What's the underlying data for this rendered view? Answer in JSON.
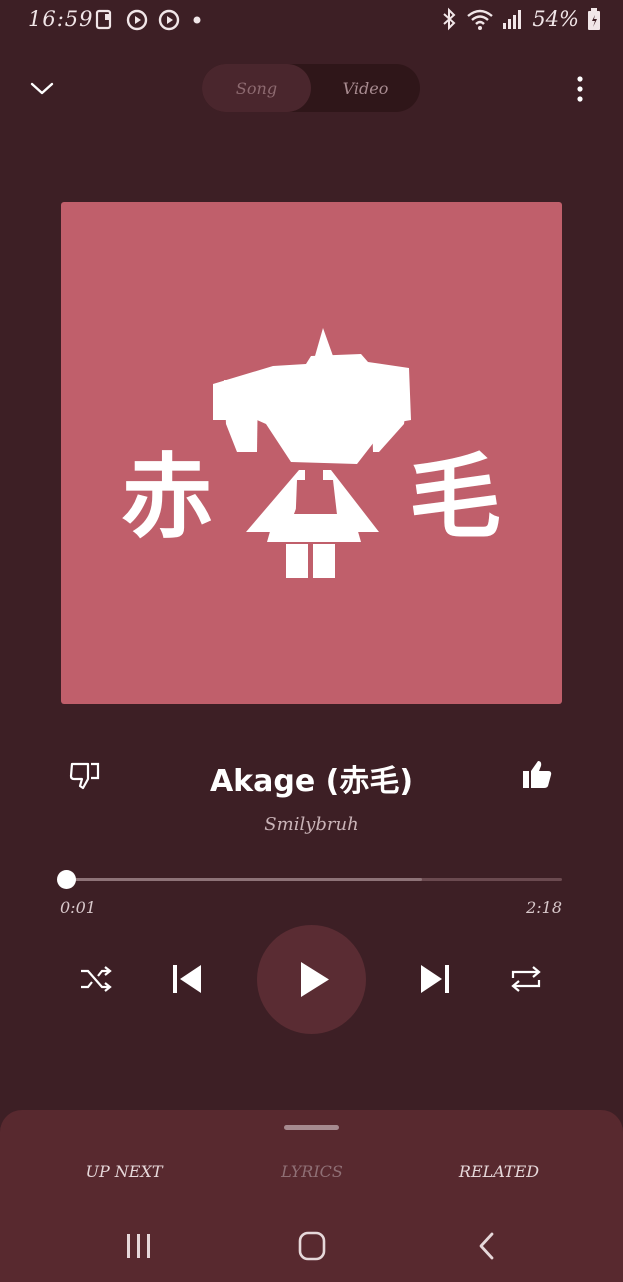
{
  "status_bar": {
    "time": "16:59",
    "battery": "54%",
    "icons": [
      "notification-icon",
      "play-circle-icon",
      "play-circle-icon",
      "dot-icon",
      "bluetooth-icon",
      "wifi-icon",
      "signal-icon",
      "battery-icon"
    ]
  },
  "header": {
    "tabs": [
      {
        "label": "Song",
        "selected": true
      },
      {
        "label": "Video",
        "selected": false
      }
    ]
  },
  "album": {
    "chars": [
      "赤",
      "毛"
    ],
    "background": "#c05f6b"
  },
  "track": {
    "title": "Akage (赤毛)",
    "artist": "Smilybruh"
  },
  "progress": {
    "elapsed": "0:01",
    "total": "2:18",
    "played_fraction": 0.007,
    "buffered_fraction": 0.72
  },
  "bottom_sheet": {
    "tabs": [
      "UP NEXT",
      "LYRICS",
      "RELATED"
    ]
  },
  "colors": {
    "background": "#3d1f25",
    "sheet": "#58292f",
    "play_circle": "#5a2c33"
  }
}
